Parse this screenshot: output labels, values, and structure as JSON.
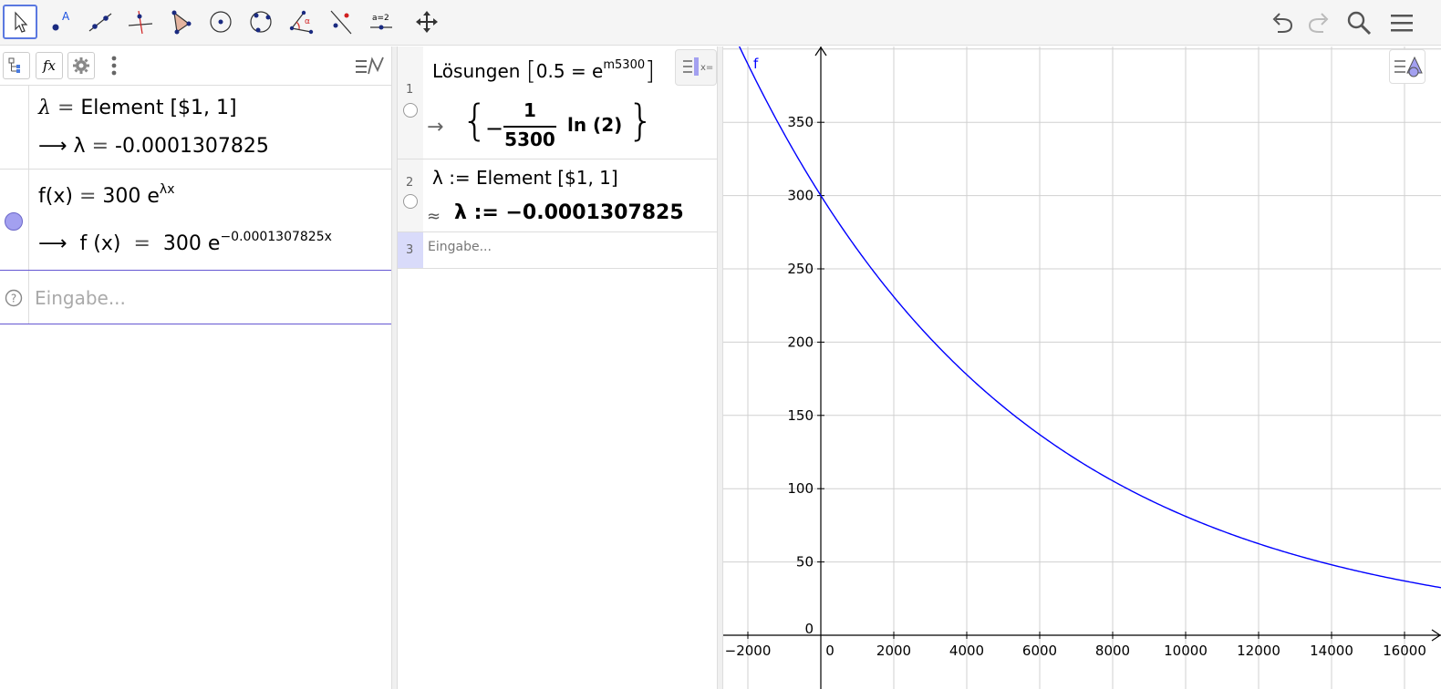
{
  "toolbar": {
    "tools": [
      {
        "name": "move-tool-icon",
        "active": true
      },
      {
        "name": "point-tool-icon"
      },
      {
        "name": "line-tool-icon"
      },
      {
        "name": "perpendicular-line-tool-icon"
      },
      {
        "name": "polygon-tool-icon"
      },
      {
        "name": "circle-center-tool-icon"
      },
      {
        "name": "circle-three-points-tool-icon"
      },
      {
        "name": "angle-tool-icon"
      },
      {
        "name": "reflect-tool-icon"
      },
      {
        "name": "slider-tool-icon",
        "label": "a=2"
      },
      {
        "name": "move-graphics-tool-icon"
      }
    ],
    "right": [
      "undo-icon",
      "redo-icon",
      "search-icon",
      "menu-icon"
    ]
  },
  "algebra": {
    "row1": {
      "def_lambda": "λ",
      "def_eq": "=",
      "def_rhs": "Element [$1, 1]",
      "arrow": "⟶",
      "res_lambda": "λ",
      "res_eq": "=",
      "res_value": "-0.0001307825"
    },
    "row2": {
      "def_lhs": "f(x)",
      "def_eq": "=",
      "def_base": "300 e",
      "def_exp": "λx",
      "arrow": "⟶",
      "res_lhs": "f (x)",
      "res_eq": "=",
      "res_base": "300 e",
      "res_exp": "−0.0001307825x",
      "color": "#a3a0f0"
    },
    "input_placeholder": "Eingabe..."
  },
  "cas": {
    "row1": {
      "num": "1",
      "cmd": "Lösungen",
      "open_bracket": "[",
      "expr": "0.5 = e",
      "expr_exp": "m5300",
      "close_bracket": "]",
      "arrow": "→",
      "open_brace": "{",
      "minus": "−",
      "num_top": "1",
      "num_bottom": "5300",
      "ln": "ln (2)",
      "close_brace": "}"
    },
    "row2": {
      "num": "2",
      "def": "λ :=  Element [$1, 1]",
      "approx": "≈",
      "res_lambda": "λ",
      "res_assign": ":=",
      "res_value": "−0.0001307825"
    },
    "row3": {
      "num": "3",
      "placeholder": "Eingabe..."
    }
  },
  "graph": {
    "function_label": "f",
    "curve_color": "#0000ff",
    "x_ticks": [
      "−2000",
      "0",
      "2000",
      "4000",
      "6000",
      "8000",
      "10000",
      "12000",
      "14000",
      "16000"
    ],
    "x_values": [
      -2000,
      0,
      2000,
      4000,
      6000,
      8000,
      10000,
      12000,
      14000,
      16000
    ],
    "y_ticks": [
      "0",
      "50",
      "100",
      "150",
      "200",
      "250",
      "300",
      "350"
    ],
    "y_values": [
      0,
      50,
      100,
      150,
      200,
      250,
      300,
      350
    ],
    "amplitude": 300,
    "lambda": -0.0001307825
  }
}
